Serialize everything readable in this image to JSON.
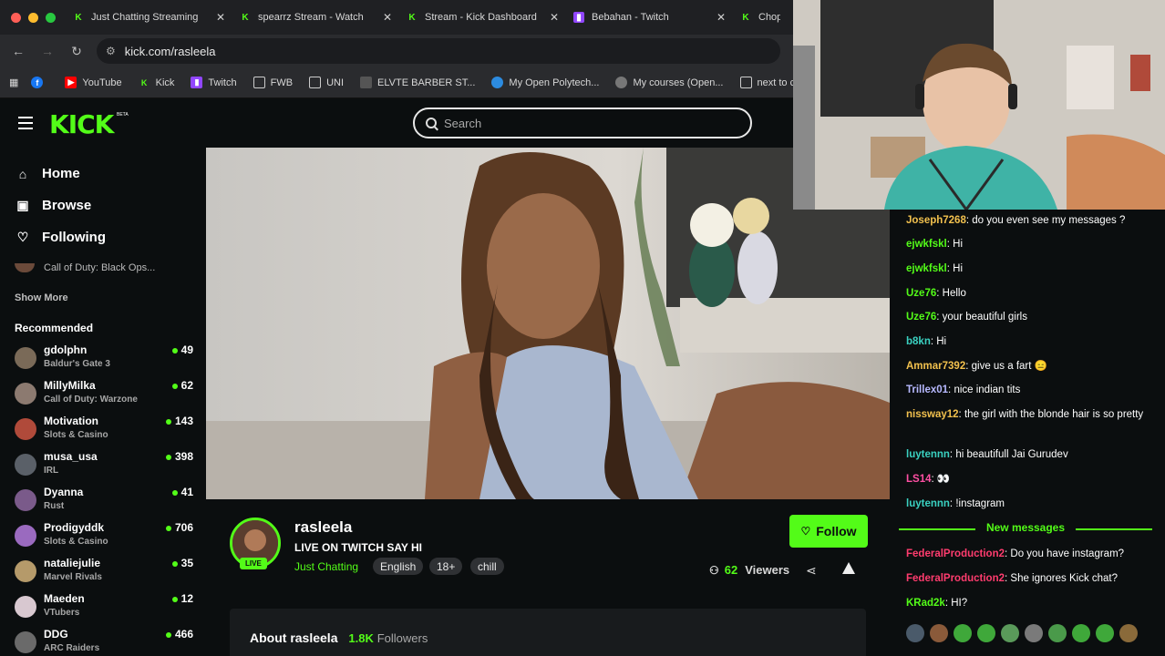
{
  "browser": {
    "tabs": [
      {
        "title": "Just Chatting Streaming",
        "icon": "kick-icon"
      },
      {
        "title": "spearrz Stream - Watch",
        "icon": "kick-icon"
      },
      {
        "title": "Stream - Kick Dashboard",
        "icon": "kick-icon"
      },
      {
        "title": "Bebahan - Twitch",
        "icon": "twitch-icon"
      },
      {
        "title": "Chops",
        "icon": "kick-icon"
      }
    ],
    "url": "kick.com/rasleela",
    "bookmarks": [
      {
        "label": "",
        "icon": "facebook-icon"
      },
      {
        "label": "YouTube",
        "icon": "youtube-icon"
      },
      {
        "label": "Kick",
        "icon": "kick-icon"
      },
      {
        "label": "Twitch",
        "icon": "twitch-icon"
      },
      {
        "label": "FWB",
        "icon": "folder-icon"
      },
      {
        "label": "UNI",
        "icon": "folder-icon"
      },
      {
        "label": "ELVTE BARBER ST...",
        "icon": "site-icon"
      },
      {
        "label": "My Open Polytech...",
        "icon": "site-icon"
      },
      {
        "label": "My courses (Open...",
        "icon": "site-icon"
      },
      {
        "label": "next to c",
        "icon": "folder-icon"
      }
    ]
  },
  "header": {
    "logo": "KICK",
    "beta": "BETA",
    "search_placeholder": "Search"
  },
  "sidebar": {
    "nav": [
      {
        "label": "Home",
        "icon": "home-icon"
      },
      {
        "label": "Browse",
        "icon": "browse-icon"
      },
      {
        "label": "Following",
        "icon": "heart-icon"
      }
    ],
    "cut_item": "Call of Duty: Black Ops...",
    "show_more": "Show More",
    "recommended_title": "Recommended",
    "channels": [
      {
        "name": "gdolphn",
        "category": "Baldur's Gate 3",
        "viewers": "49",
        "color": "#7a6a58"
      },
      {
        "name": "MillyMilka",
        "category": "Call of Duty: Warzone",
        "viewers": "62",
        "color": "#8c7a70"
      },
      {
        "name": "Motivation",
        "category": "Slots & Casino",
        "viewers": "143",
        "color": "#b04a3a"
      },
      {
        "name": "musa_usa",
        "category": "IRL",
        "viewers": "398",
        "color": "#5a6068"
      },
      {
        "name": "Dyanna",
        "category": "Rust",
        "viewers": "41",
        "color": "#7a5a8a"
      },
      {
        "name": "Prodigyddk",
        "category": "Slots & Casino",
        "viewers": "706",
        "color": "#9a6abf"
      },
      {
        "name": "nataliejulie",
        "category": "Marvel Rivals",
        "viewers": "35",
        "color": "#b59a6a"
      },
      {
        "name": "Maeden",
        "category": "VTubers",
        "viewers": "12",
        "color": "#d8c8d0"
      },
      {
        "name": "DDG",
        "category": "ARC Raiders",
        "viewers": "466",
        "color": "#6a6a6a"
      }
    ]
  },
  "stream": {
    "name": "rasleela",
    "title": "LIVE ON TWITCH SAY HI",
    "category": "Just Chatting",
    "tags": [
      "English",
      "18+",
      "chill"
    ],
    "live": "LIVE",
    "follow": "Follow",
    "viewers_count": "62",
    "viewers_label": "Viewers",
    "about_label": "About rasleela",
    "followers_count": "1.8K",
    "followers_label": "Followers"
  },
  "chat": {
    "messages": [
      {
        "user": "Joseph7268",
        "text": " do you even see my messages ?",
        "color": "#f2c14e"
      },
      {
        "user": "ejwkfskl",
        "text": " Hi",
        "color": "#53fc18"
      },
      {
        "user": "ejwkfskl",
        "text": " Hi",
        "color": "#53fc18"
      },
      {
        "user": "Uze76",
        "text": " Hello",
        "color": "#53fc18"
      },
      {
        "user": "Uze76",
        "text": " your beautiful girls",
        "color": "#53fc18"
      },
      {
        "user": "b8kn",
        "text": " Hi",
        "color": "#3ad1c1"
      },
      {
        "user": "Ammar7392",
        "text": " give us a fart 😑",
        "color": "#f2c14e"
      },
      {
        "user": "Trillex01",
        "text": " nice indian tits",
        "color": "#b7b9ff"
      },
      {
        "user": "nissway12",
        "text": " the girl with the blonde hair is so pretty",
        "color": "#f2c14e"
      },
      {
        "user": "luytennn",
        "text": " hi beautifull Jai Gurudev",
        "color": "#3ad1c1"
      },
      {
        "user": "LS14",
        "text": " 👀",
        "color": "#ff4fa3"
      },
      {
        "user": "luytennn",
        "text": " !instagram",
        "color": "#3ad1c1"
      }
    ],
    "new_messages": "New messages",
    "new": [
      {
        "user": "FederalProduction2",
        "text": " Do you have instagram?",
        "color": "#ff3c6e"
      },
      {
        "user": "FederalProduction2",
        "text": " She ignores Kick chat?",
        "color": "#ff3c6e"
      },
      {
        "user": "KRad2k",
        "text": " HI?",
        "color": "#53fc18"
      }
    ]
  },
  "colors": {
    "accent": "#53fc18",
    "bg": "#0b0e0f"
  }
}
